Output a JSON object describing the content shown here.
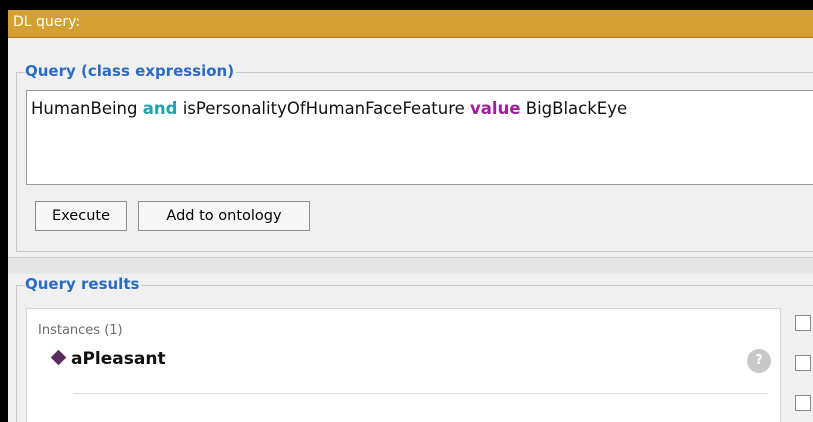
{
  "window": {
    "title": "DL query:"
  },
  "query_section": {
    "label": "Query (class expression)",
    "expression": {
      "part1": "HumanBeing ",
      "kw1": "and",
      "part2": " isPersonalityOfHumanFaceFeature ",
      "kw2": "value",
      "part3": " BigBlackEye"
    },
    "buttons": {
      "execute": "Execute",
      "add_to_ontology": "Add to ontology"
    }
  },
  "results_section": {
    "label": "Query results",
    "instances_header": "Instances (1)",
    "items": [
      {
        "name": "aPleasant",
        "icon": "individual-diamond-icon"
      }
    ],
    "help_icon_text": "?"
  },
  "colors": {
    "titlebar": "#d4a032",
    "group_label": "#2a6cc4",
    "keyword_and": "#1fa3b3",
    "keyword_value": "#a01ea0",
    "individual_icon": "#5c2d5c"
  }
}
